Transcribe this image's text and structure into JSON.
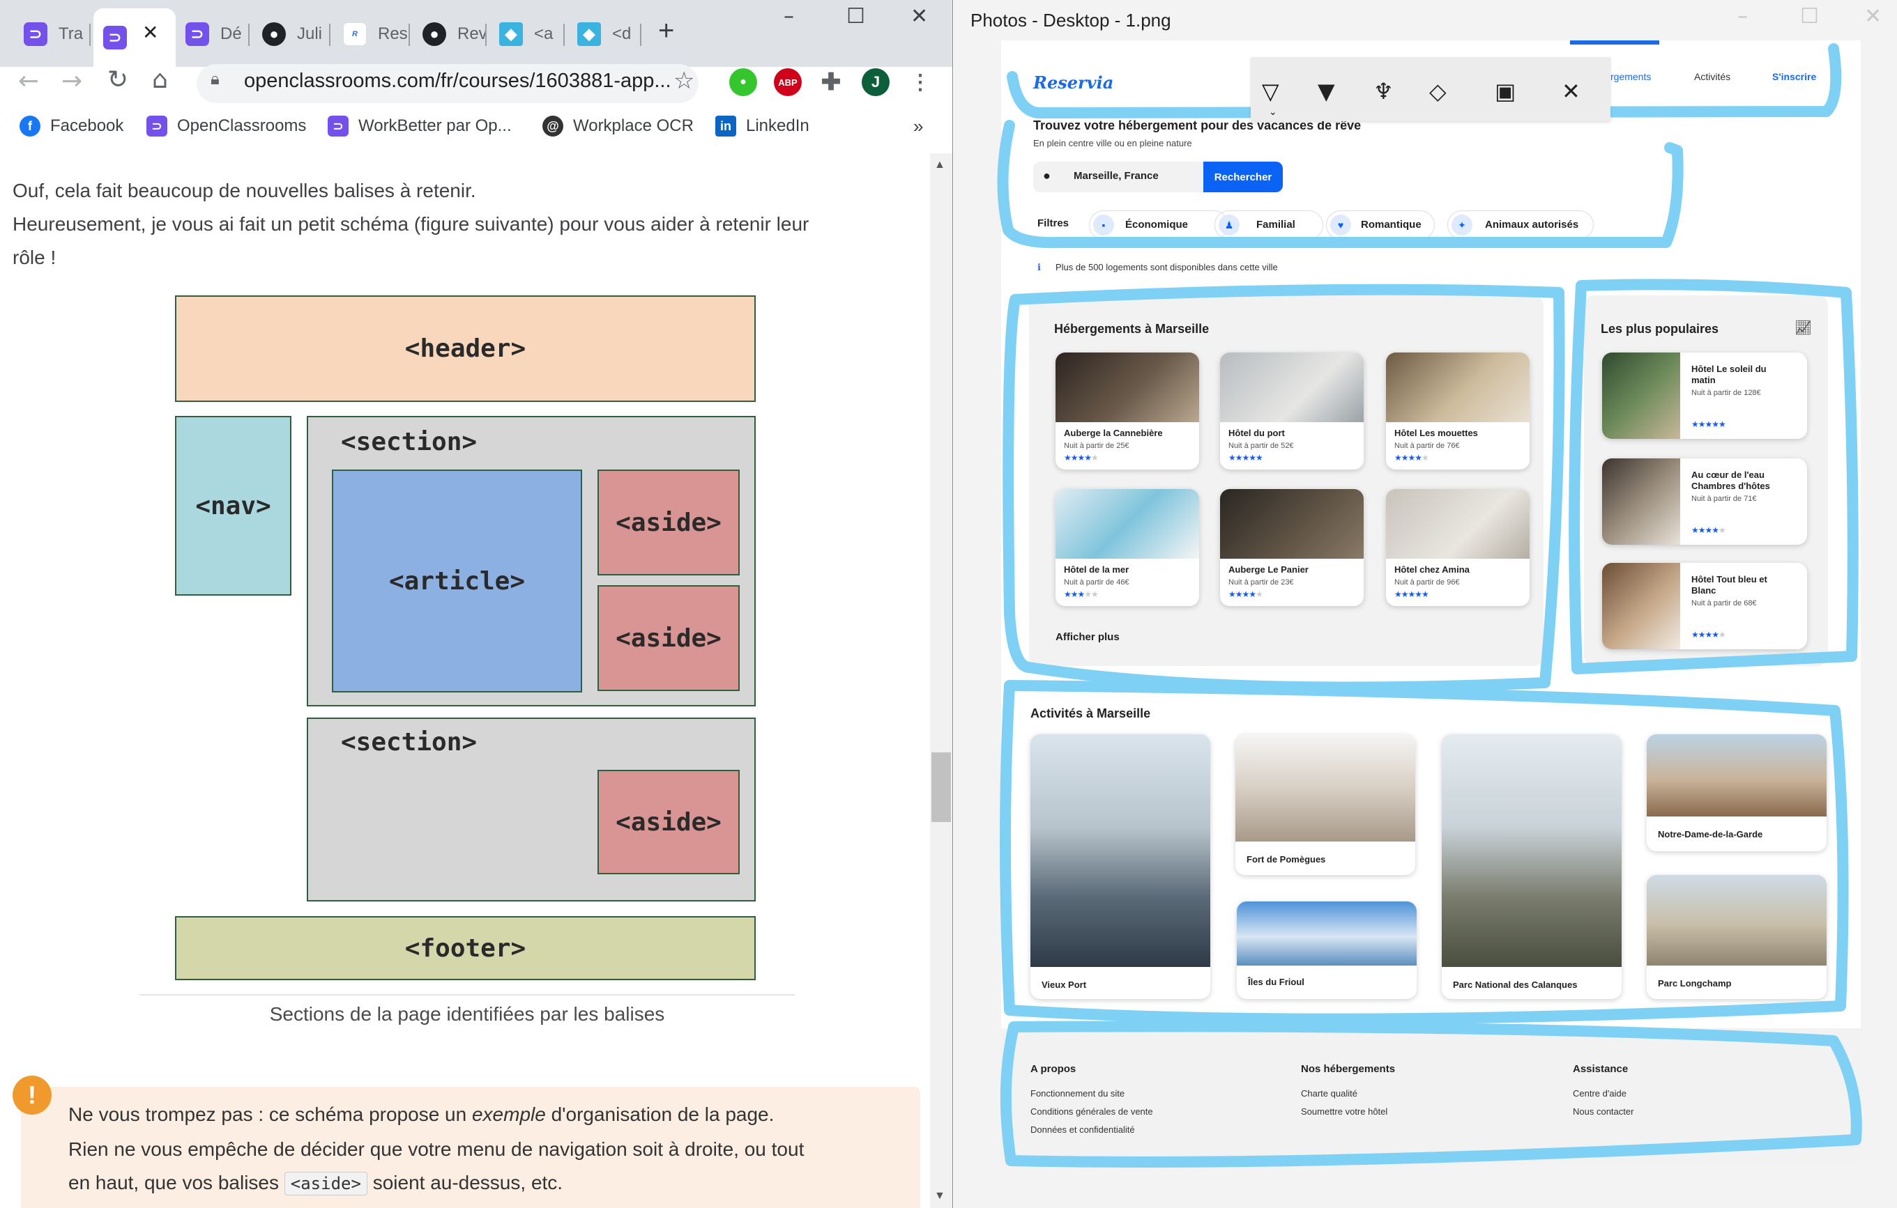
{
  "browser": {
    "tabs": [
      {
        "label": "Tra",
        "icon": "openclassrooms-icon"
      },
      {
        "label": "",
        "icon": "openclassrooms-icon",
        "active": true
      },
      {
        "label": "Dé",
        "icon": "openclassrooms-icon"
      },
      {
        "label": "Juli",
        "icon": "github-icon"
      },
      {
        "label": "Res",
        "icon": "reservia-icon"
      },
      {
        "label": "Rev",
        "icon": "github-icon"
      },
      {
        "label": "<a",
        "icon": "tag-icon"
      },
      {
        "label": "<d",
        "icon": "tag-icon"
      }
    ],
    "new_tab": "+",
    "url": "openclassrooms.com/fr/courses/1603881-app...",
    "profile_initial": "J",
    "adblock_label": "ABP",
    "bookmarks": [
      {
        "label": "Facebook",
        "icon": "facebook-icon",
        "color": "#1877f2"
      },
      {
        "label": "OpenClassrooms",
        "icon": "openclassrooms-icon",
        "color": "#7451eb"
      },
      {
        "label": "WorkBetter par Op...",
        "icon": "openclassrooms-icon",
        "color": "#7451eb"
      },
      {
        "label": "Workplace OCR",
        "icon": "workplace-icon",
        "color": "#333333"
      },
      {
        "label": "LinkedIn",
        "icon": "linkedin-icon",
        "color": "#0a66c2"
      }
    ],
    "bookmarks_more": "»"
  },
  "article": {
    "para1": "Ouf, cela fait beaucoup de nouvelles balises à retenir.",
    "para2": "Heureusement, je vous ai fait un petit schéma (figure suivante) pour vous aider à retenir leur",
    "para3": "rôle !",
    "diagram": {
      "header": "<header>",
      "nav": "<nav>",
      "section": "<section>",
      "article": "<article>",
      "aside": "<aside>",
      "footer": "<footer>",
      "colors": {
        "header": "#f9d7bd",
        "nav": "#abd8df",
        "section": "#d6d6d6",
        "article": "#8db0e3",
        "aside": "#d99593",
        "footer": "#d4d7a9"
      }
    },
    "caption": "Sections de la page identifiées par les balises",
    "note_line1_a": "Ne vous trompez pas : ce schéma propose un ",
    "note_line1_em": "exemple",
    "note_line1_b": " d'organisation de la page.",
    "note_line2": "Rien ne vous empêche de décider que votre menu de navigation soit à droite, ou tout",
    "note_line3_a": "en haut, que vos balises ",
    "note_code": "<aside>",
    "note_line3_b": " soient au-dessus, etc.",
    "warn_icon": "!"
  },
  "photos": {
    "title": "Photos - Desktop - 1.png",
    "ink_tools": [
      "ballpoint-pen-icon",
      "pencil-icon",
      "highlighter-icon",
      "eraser-icon",
      "save-icon",
      "close-icon"
    ],
    "ink_color": "#7fd0f5"
  },
  "reservia": {
    "logo": "Reservia",
    "nav": {
      "hebergements": "rgements",
      "activites": "Activités",
      "inscrire": "S'inscrire"
    },
    "search_title": "Trouvez votre hébergement pour des vacances de rêve",
    "search_sub": "En plein centre ville ou en pleine nature",
    "search_value": "Marseille, France",
    "search_button": "Rechercher",
    "filters_label": "Filtres",
    "filters": [
      "Économique",
      "Familial",
      "Romantique",
      "Animaux autorisés"
    ],
    "info": "Plus de 500 logements sont disponibles dans cette ville",
    "hebergements_title": "Hébergements à Marseille",
    "hebergements": [
      {
        "name": "Auberge la Cannebière",
        "price": "Nuit à partir de 25€",
        "stars": 4
      },
      {
        "name": "Hôtel du port",
        "price": "Nuit à partir de 52€",
        "stars": 5
      },
      {
        "name": "Hôtel Les mouettes",
        "price": "Nuit à partir de 76€",
        "stars": 4
      },
      {
        "name": "Hôtel de la mer",
        "price": "Nuit à partir de 46€",
        "stars": 3
      },
      {
        "name": "Auberge Le Panier",
        "price": "Nuit à partir de 23€",
        "stars": 4
      },
      {
        "name": "Hôtel chez Amina",
        "price": "Nuit à partir de 96€",
        "stars": 5
      }
    ],
    "show_more": "Afficher plus",
    "popular_title": "Les plus populaires",
    "popular": [
      {
        "name1": "Hôtel Le soleil du",
        "name2": "matin",
        "price": "Nuit à partir de 128€",
        "stars": 5
      },
      {
        "name1": "Au cœur de l'eau",
        "name2": "Chambres d'hôtes",
        "price": "Nuit à partir de 71€",
        "stars": 4
      },
      {
        "name1": "Hôtel Tout bleu et",
        "name2": "Blanc",
        "price": "Nuit à partir de 68€",
        "stars": 4
      }
    ],
    "activities_title": "Activités à Marseille",
    "activities": [
      "Vieux Port",
      "Fort de Pomègues",
      "Îles du Frioul",
      "Parc National des Calanques",
      "Notre-Dame-de-la-Garde",
      "Parc Longchamp"
    ],
    "footer": {
      "col1_title": "A propos",
      "col1": [
        "Fonctionnement du site",
        "Conditions générales de vente",
        "Données et confidentialité"
      ],
      "col2_title": "Nos hébergements",
      "col2": [
        "Charte qualité",
        "Soumettre votre hôtel"
      ],
      "col3_title": "Assistance",
      "col3": [
        "Centre d'aide",
        "Nous contacter"
      ]
    }
  }
}
